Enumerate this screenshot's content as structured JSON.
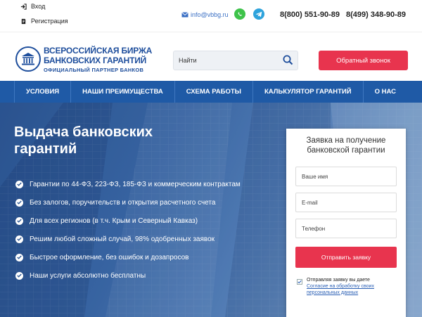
{
  "topbar": {
    "login_label": "Вход",
    "register_label": "Регистрация",
    "email": "info@vbbg.ru",
    "phone1": "8(800) 551-90-89",
    "phone2": "8(499) 348-90-89"
  },
  "header": {
    "brand_line1": "ВСЕРОССИЙСКАЯ БИРЖА",
    "brand_line2": "БАНКОВСКИХ ГАРАНТИЙ",
    "brand_line3": "ОФИЦИАЛЬНЫЙ ПАРТНЕР БАНКОВ",
    "search_placeholder": "Найти",
    "callback_label": "Обратный звонок"
  },
  "nav": {
    "items": [
      {
        "label": "УСЛОВИЯ"
      },
      {
        "label": "НАШИ ПРЕИМУЩЕСТВА"
      },
      {
        "label": "СХЕМА РАБОТЫ"
      },
      {
        "label": "КАЛЬКУЛЯТОР ГАРАНТИЙ"
      },
      {
        "label": "О НАС"
      }
    ]
  },
  "hero": {
    "title": "Выдача банковских гарантий",
    "features": [
      "Гарантии по 44-ФЗ, 223-ФЗ, 185-ФЗ и коммерческим контрактам",
      "Без залогов, поручительств и открытия расчетного счета",
      "Для всех регионов (в т.ч. Крым и Северный Кавказ)",
      "Решим любой сложный случай, 98% одобренных заявок",
      "Быстрое оформление, без ошибок и дозапросов",
      "Наши услуги абсолютно бесплатны"
    ]
  },
  "form": {
    "title": "Заявка на получение банковской гарантии",
    "name_placeholder": "Ваше имя",
    "email_placeholder": "E-mail",
    "phone_placeholder": "Телефон",
    "submit_label": "Отправить заявку",
    "agree_text": "Отправляя заявку вы даете",
    "agree_link": "Согласие на обработку своих персональных данных"
  },
  "colors": {
    "brand_blue": "#1e4e9c",
    "nav_blue": "#1f5aa6",
    "accent_red": "#e8344e",
    "whatsapp_green": "#3ec34a",
    "telegram_blue": "#2ea3dc"
  },
  "icons": [
    "login-icon",
    "register-icon",
    "mail-icon",
    "whatsapp-icon",
    "telegram-icon",
    "search-icon",
    "check-icon",
    "logo-building-icon"
  ]
}
